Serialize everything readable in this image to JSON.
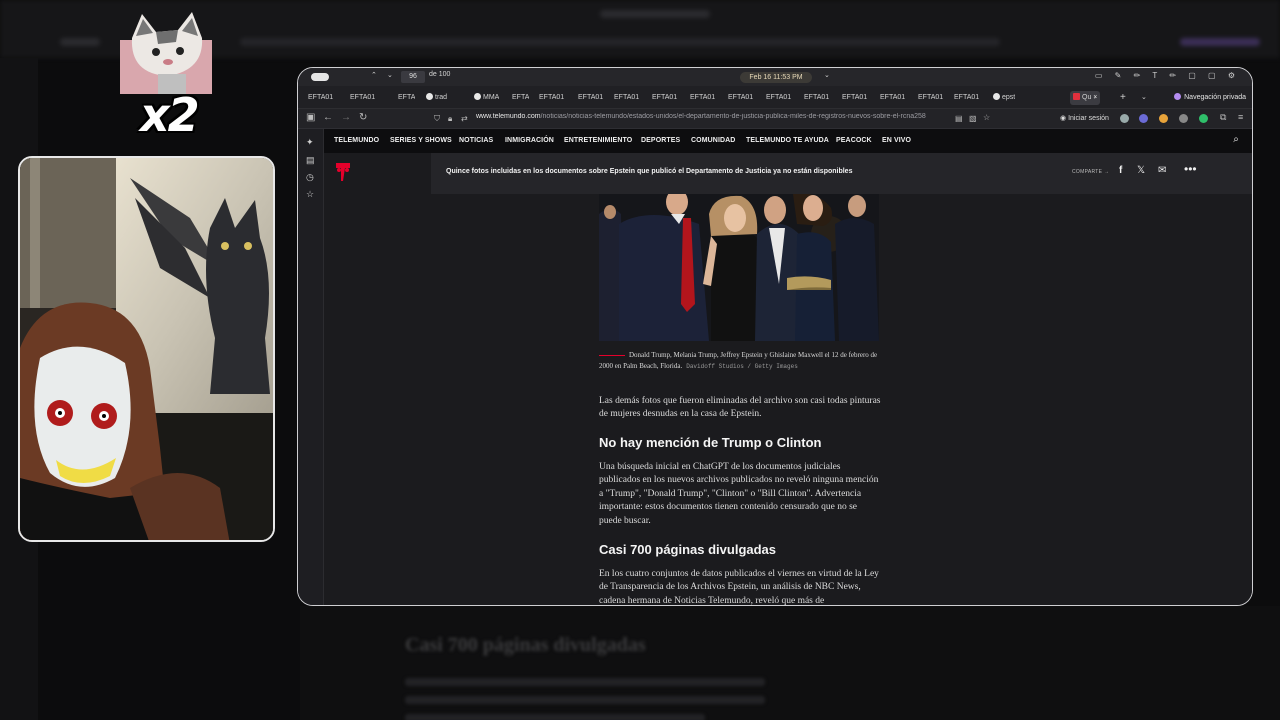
{
  "overlay": {
    "multiplier": "x2"
  },
  "browser": {
    "pdf_page": "96",
    "pdf_of": "de 100",
    "clock": "Feb 16 11:53 PM",
    "tabs": [
      "EFTA01",
      "EFTA01",
      "EFTA",
      "trad",
      "MMA",
      "EFTA",
      "EFTA01",
      "EFTA01",
      "EFTA01",
      "EFTA01",
      "EFTA01",
      "EFTA01",
      "EFTA01",
      "EFTA01",
      "EFTA01",
      "EFTA01",
      "EFTA01",
      "EFTA01",
      "epst",
      "Qu"
    ],
    "private_label": "Navegación privada",
    "url_domain": "www.telemundo.com",
    "url_path": "/noticias/noticias-telemundo/estados-unidos/el-departamento-de-justicia-publica-miles-de-registros-nuevos-sobre-el-rcna258",
    "signin": "Iniciar sesión"
  },
  "site": {
    "nav": [
      "TELEMUNDO",
      "SERIES Y SHOWS",
      "NOTICIAS",
      "INMIGRACIÓN",
      "ENTRETENIMIENTO",
      "DEPORTES",
      "COMUNIDAD",
      "TELEMUNDO TE AYUDA",
      "PEACOCK",
      "EN VIVO"
    ],
    "sticky_headline": "Quince fotos incluidas en los documentos sobre Epstein que publicó el Departamento de Justicia ya no están disponibles",
    "share_label": "COMPARTE →",
    "brand_color": "#e4002b"
  },
  "article": {
    "caption": "Donald Trump, Melania Trump, Jeffrey Epstein y Ghislaine Maxwell el 12 de febrero de 2000 en Palm Beach, Florida.",
    "credit": "Davidoff Studios / Getty Images",
    "p1": "Las demás fotos que fueron eliminadas del archivo son casi todas pinturas de mujeres desnudas en la casa de Epstein.",
    "h1": "No hay mención de Trump o Clinton",
    "p2": "Una búsqueda inicial en ChatGPT de los documentos judiciales publicados en los nuevos archivos publicados no reveló ninguna mención a \"Trump\", \"Donald Trump\", \"Clinton\" o \"Bill Clinton\". Advertencia importante: estos documentos tienen contenido censurado que no se puede buscar.",
    "h2": "Casi 700 páginas divulgadas",
    "p3": "En los cuatro conjuntos de datos publicados el viernes en virtud de la Ley de Transparencia de los Archivos Epstein, un análisis de NBC News, cadena hermana de Noticias Telemundo, reveló que más de"
  },
  "background": {
    "ghost_heading": "Casi 700 páginas divulgadas"
  }
}
